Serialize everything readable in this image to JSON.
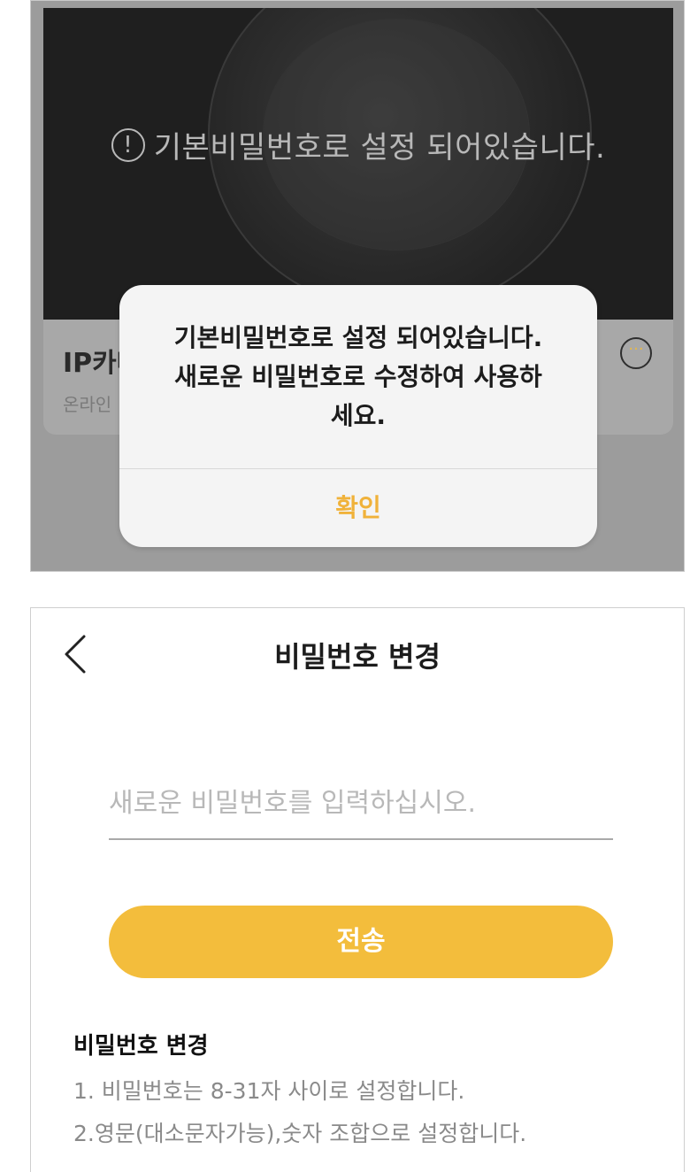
{
  "top_screen": {
    "camera_warning": "기본비밀번호로 설정 되어있습니다.",
    "device": {
      "name": "IP카메라",
      "status": "온라인"
    },
    "more_icon": "ellipsis-icon"
  },
  "alert": {
    "message_line1": "기본비밀번호로 설정 되어있습니다.",
    "message_line2": "새로운 비밀번호로 수정하여 사용하",
    "message_line3": "세요.",
    "confirm_label": "확인"
  },
  "password_change": {
    "title": "비밀번호 변경",
    "back_icon": "chevron-left-icon",
    "input_placeholder": "새로운 비밀번호를 입력하십시오.",
    "input_value": "",
    "submit_label": "전송",
    "info_title": "비밀번호 변경",
    "info_lines": [
      "1. 비밀번호는 8-31자 사이로 설정합니다.",
      "2.영문(대소문자가능),숫자 조합으로 설정합니다."
    ]
  },
  "colors": {
    "accent": "#f3bd3c",
    "alert_button": "#f0b23a",
    "dim_overlay": "#9c9c9c"
  }
}
